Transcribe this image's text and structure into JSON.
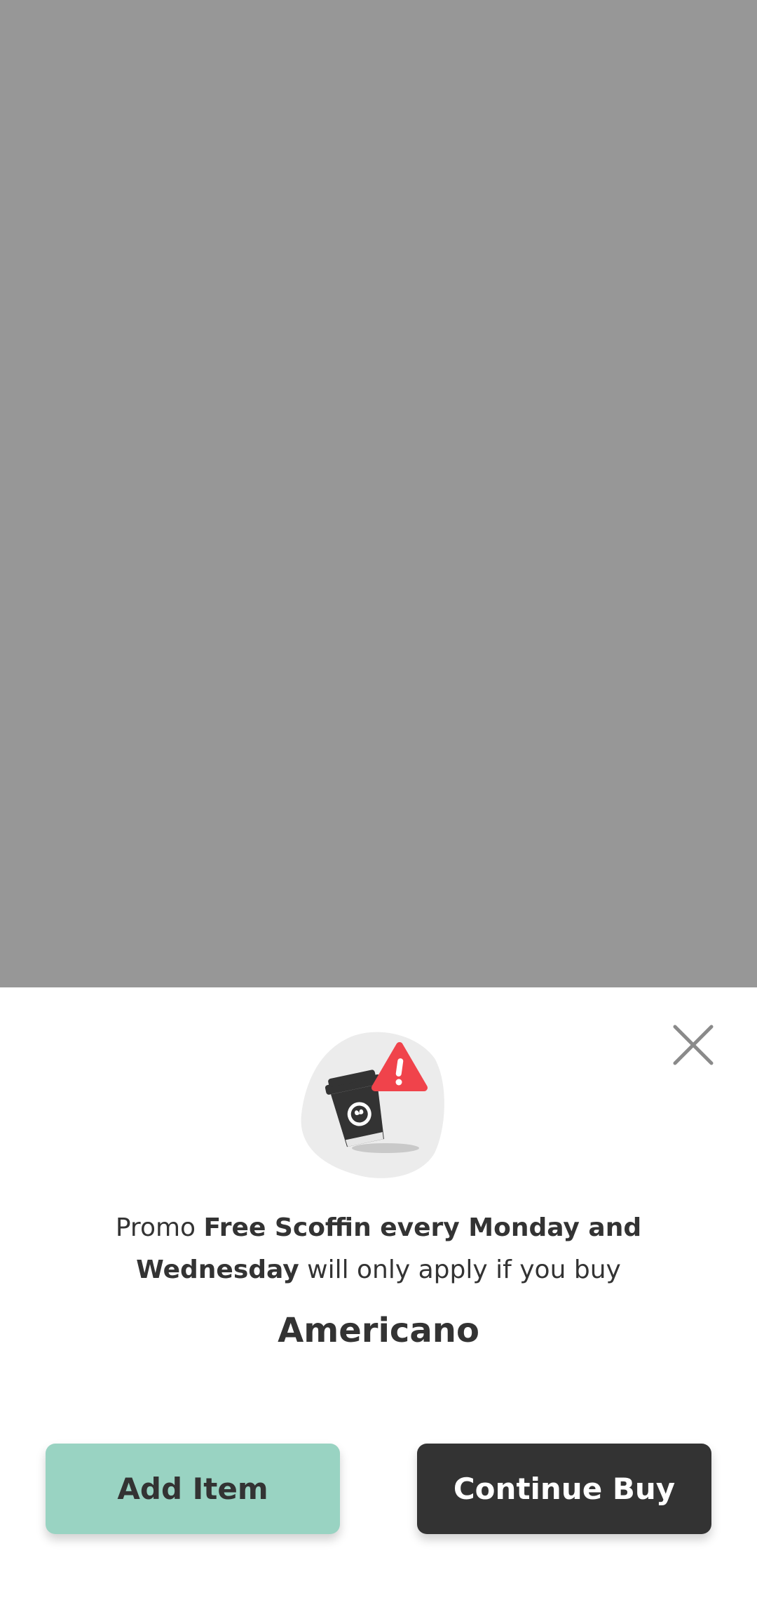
{
  "overlay": {
    "color": "#979797"
  },
  "sheet": {
    "close_icon": "close-icon",
    "illustration_icon": "coffee-cup-warning-icon",
    "promo": {
      "prefix": "Promo ",
      "name_bold": "Free Scoffin every Monday and Wednesday",
      "suffix": " will only apply if you buy"
    },
    "product_name": "Americano",
    "buttons": {
      "add_item_label": "Add Item",
      "continue_buy_label": "Continue Buy"
    },
    "colors": {
      "add_item_bg": "#99d3c2",
      "continue_buy_bg": "#333333",
      "warning": "#f0434b"
    }
  }
}
